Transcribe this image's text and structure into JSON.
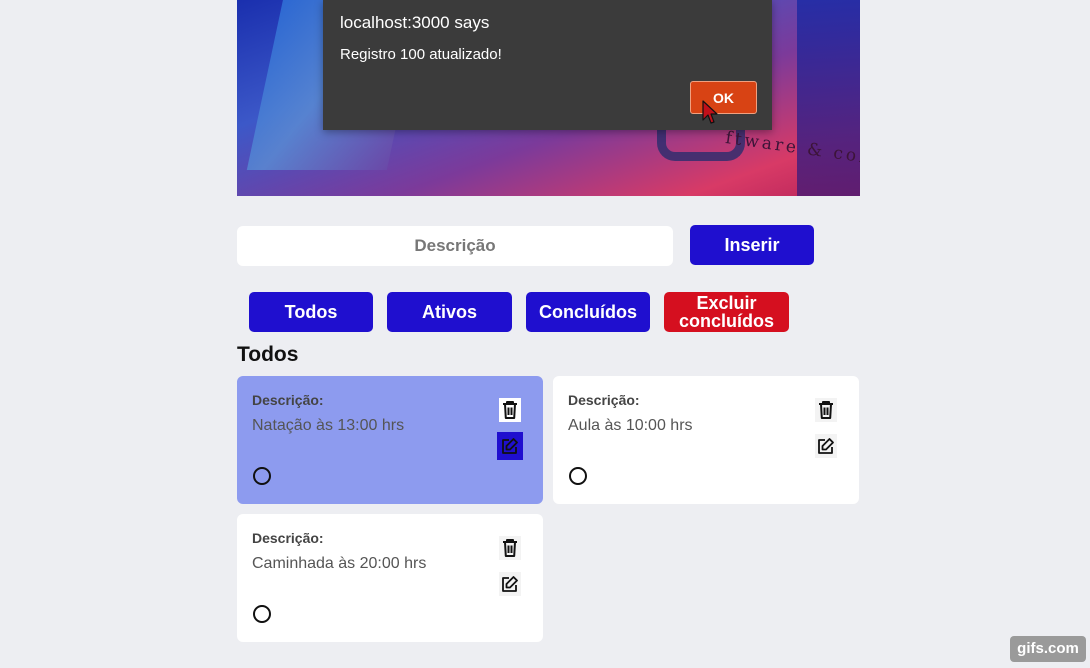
{
  "dialog": {
    "title": "localhost:3000 says",
    "message": "Registro 100 atualizado!",
    "ok_label": "OK"
  },
  "banner": {
    "brand_text": "ftware & consultoria"
  },
  "form": {
    "description_placeholder": "Descrição",
    "insert_label": "Inserir"
  },
  "filters": {
    "all_label": "Todos",
    "active_label": "Ativos",
    "completed_label": "Concluídos",
    "clear_completed_label": "Excluir concluídos"
  },
  "section_title": "Todos",
  "todos": [
    {
      "label": "Descrição:",
      "description": "Natação às 13:00 hrs",
      "highlighted": true
    },
    {
      "label": "Descrição:",
      "description": "Aula às 10:00 hrs",
      "highlighted": false
    },
    {
      "label": "Descrição:",
      "description": "Caminhada às 20:00 hrs",
      "highlighted": false
    }
  ],
  "colors": {
    "primary": "#1f0fcf",
    "danger": "#d50f1f",
    "dialog_ok": "#d84314",
    "highlight_card": "#8d9bef"
  },
  "watermark": "gifs.com"
}
